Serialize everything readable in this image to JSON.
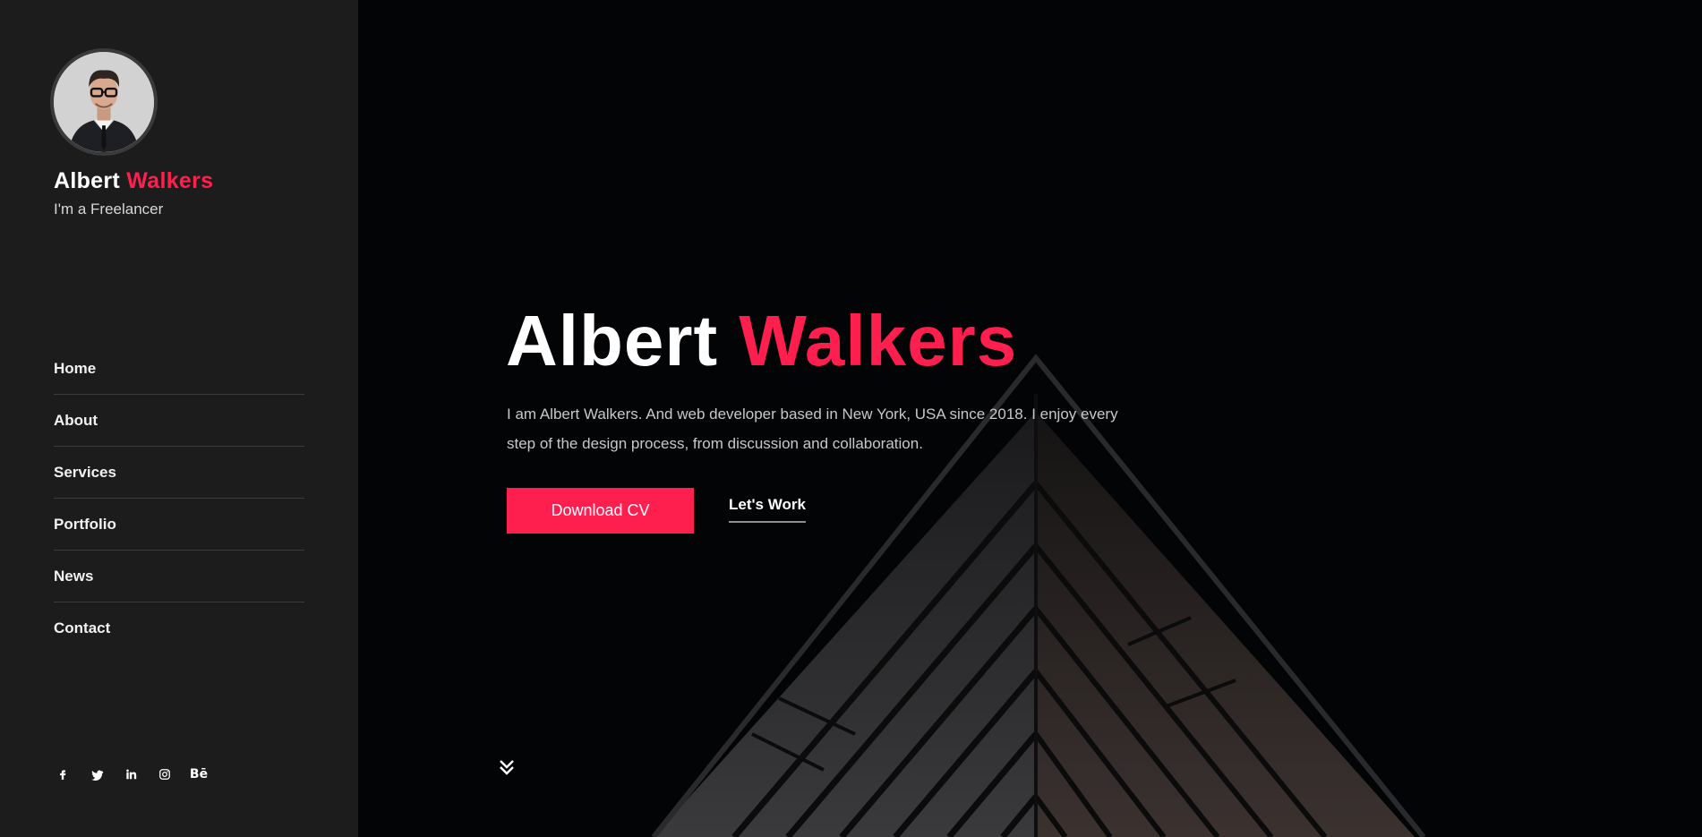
{
  "sidebar": {
    "name_first": "Albert",
    "name_last": "Walkers",
    "role": "I'm a Freelancer",
    "nav": [
      {
        "label": "Home"
      },
      {
        "label": "About"
      },
      {
        "label": "Services"
      },
      {
        "label": "Portfolio"
      },
      {
        "label": "News"
      },
      {
        "label": "Contact"
      }
    ],
    "socials": [
      {
        "icon": "facebook-icon",
        "glyph": "f"
      },
      {
        "icon": "twitter-icon",
        "glyph": "🐦"
      },
      {
        "icon": "linkedin-icon",
        "glyph": "in"
      },
      {
        "icon": "instagram-icon",
        "glyph": "◎"
      },
      {
        "icon": "behance-icon",
        "glyph": "Bē"
      }
    ]
  },
  "hero": {
    "title_first": "Albert",
    "title_last": "Walkers",
    "description": "I am Albert Walkers. And web developer based in New York, USA since 2018. I enjoy every step of the design process, from discussion and collaboration.",
    "download_label": "Download CV",
    "work_label": "Let's Work",
    "scroll_icon": "chevron-double-down-icon"
  },
  "colors": {
    "accent": "#ff1f4f",
    "sidebar_bg": "#1c1c1c",
    "hero_bg": "#030406"
  }
}
